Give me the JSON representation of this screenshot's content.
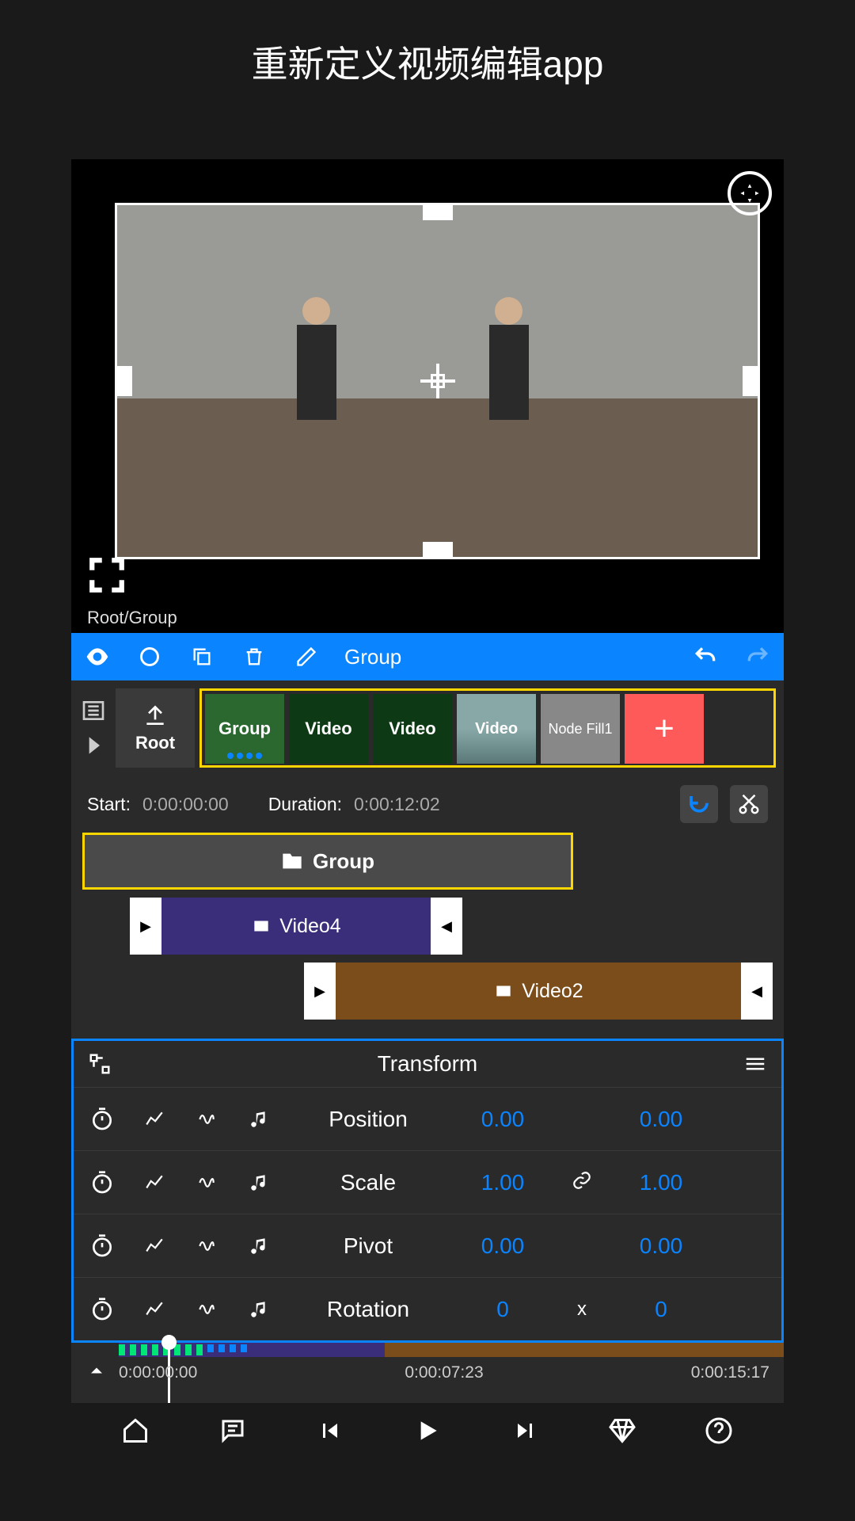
{
  "page_title": "重新定义视频编辑app",
  "breadcrumb": "Root/Group",
  "toolbar": {
    "group_label": "Group"
  },
  "nodes": {
    "root_label": "Root",
    "items": [
      {
        "label": "Group",
        "type": "group"
      },
      {
        "label": "Video",
        "type": "video"
      },
      {
        "label": "Video",
        "type": "video"
      },
      {
        "label": "Video",
        "type": "video-thumb"
      },
      {
        "label": "Node Fill1",
        "type": "fill"
      }
    ],
    "add_label": "+"
  },
  "time_info": {
    "start_label": "Start:",
    "start_value": "0:00:00:00",
    "duration_label": "Duration:",
    "duration_value": "0:00:12:02"
  },
  "clips": {
    "group_label": "Group",
    "video4_label": "Video4",
    "video2_label": "Video2"
  },
  "transform": {
    "title": "Transform",
    "rows": [
      {
        "label": "Position",
        "v1": "0.00",
        "link": "",
        "v2": "0.00"
      },
      {
        "label": "Scale",
        "v1": "1.00",
        "link": "🔗",
        "v2": "1.00"
      },
      {
        "label": "Pivot",
        "v1": "0.00",
        "link": "",
        "v2": "0.00"
      },
      {
        "label": "Rotation",
        "v1": "0",
        "link": "x",
        "v2": "0"
      }
    ]
  },
  "timeline": {
    "t0": "0:00:00:00",
    "t1": "0:00:07:23",
    "t2": "0:00:15:17"
  }
}
